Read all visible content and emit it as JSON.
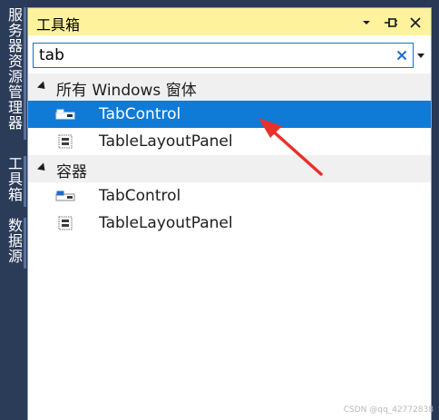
{
  "side_tabs": [
    {
      "label": "服务器资源管理器"
    },
    {
      "label": "工具箱"
    },
    {
      "label": "数据源"
    }
  ],
  "toolbox": {
    "title": "工具箱",
    "buttons": {
      "dropdown": "▾",
      "pin": "⊣",
      "close": "✕"
    },
    "search": {
      "value": "tab",
      "clear_glyph": "✕"
    },
    "groups": [
      {
        "label": "所有 Windows 窗体",
        "items": [
          {
            "label": "TabControl",
            "icon": "tabcontrol-icon",
            "selected": true
          },
          {
            "label": "TableLayoutPanel",
            "icon": "tablelayoutpanel-icon",
            "selected": false
          }
        ]
      },
      {
        "label": "容器",
        "items": [
          {
            "label": "TabControl",
            "icon": "tabcontrol-icon",
            "selected": false
          },
          {
            "label": "TableLayoutPanel",
            "icon": "tablelayoutpanel-icon",
            "selected": false
          }
        ]
      }
    ]
  },
  "watermark": "CSDN @qq_42772838",
  "colors": {
    "title_bar": "#fff29d",
    "selection": "#0f7bd6",
    "dock_background": "#293955",
    "annotation_arrow": "#e8312a"
  }
}
